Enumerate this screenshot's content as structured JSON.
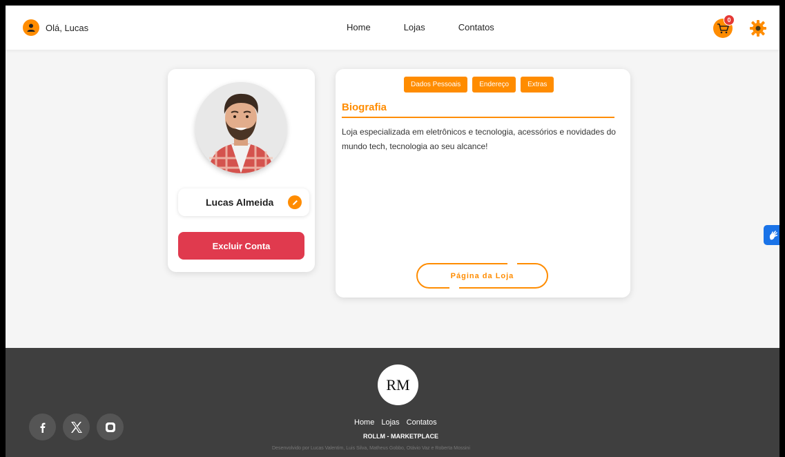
{
  "nav": {
    "greeting": "Olá, Lucas",
    "links": [
      "Home",
      "Lojas",
      "Contatos"
    ],
    "cart_count": "0",
    "accent": "#ff8c00"
  },
  "profile": {
    "name": "Lucas Almeida",
    "delete_label": "Excluir Conta",
    "avatar_icon": "person-photo",
    "edit_icon": "pencil-icon"
  },
  "bio": {
    "tabs": [
      "Dados Pessoais",
      "Endereço",
      "Extras"
    ],
    "title": "Biografia",
    "text": "Loja especializada em eletrônicos e tecnologia, acessórios e novidades do mundo tech, tecnologia ao seu alcance!",
    "store_button": "Página da Loja"
  },
  "footer": {
    "logo_text": "RM",
    "links": [
      "Home",
      "Lojas",
      "Contatos"
    ],
    "brand": "ROLLM - MARKETPLACE",
    "credits": "Desenvolvido por Lucas Valentim, Luis Silva, Matheus Gobbo, Otávio Vaz e Roberta Mossini",
    "social_icons": [
      "facebook-icon",
      "x-icon",
      "instagram-icon"
    ]
  },
  "colors": {
    "accent": "#ff8c00",
    "danger": "#e03a4e",
    "footer_bg": "#3f3f3f",
    "access_blue": "#1a73e8"
  }
}
